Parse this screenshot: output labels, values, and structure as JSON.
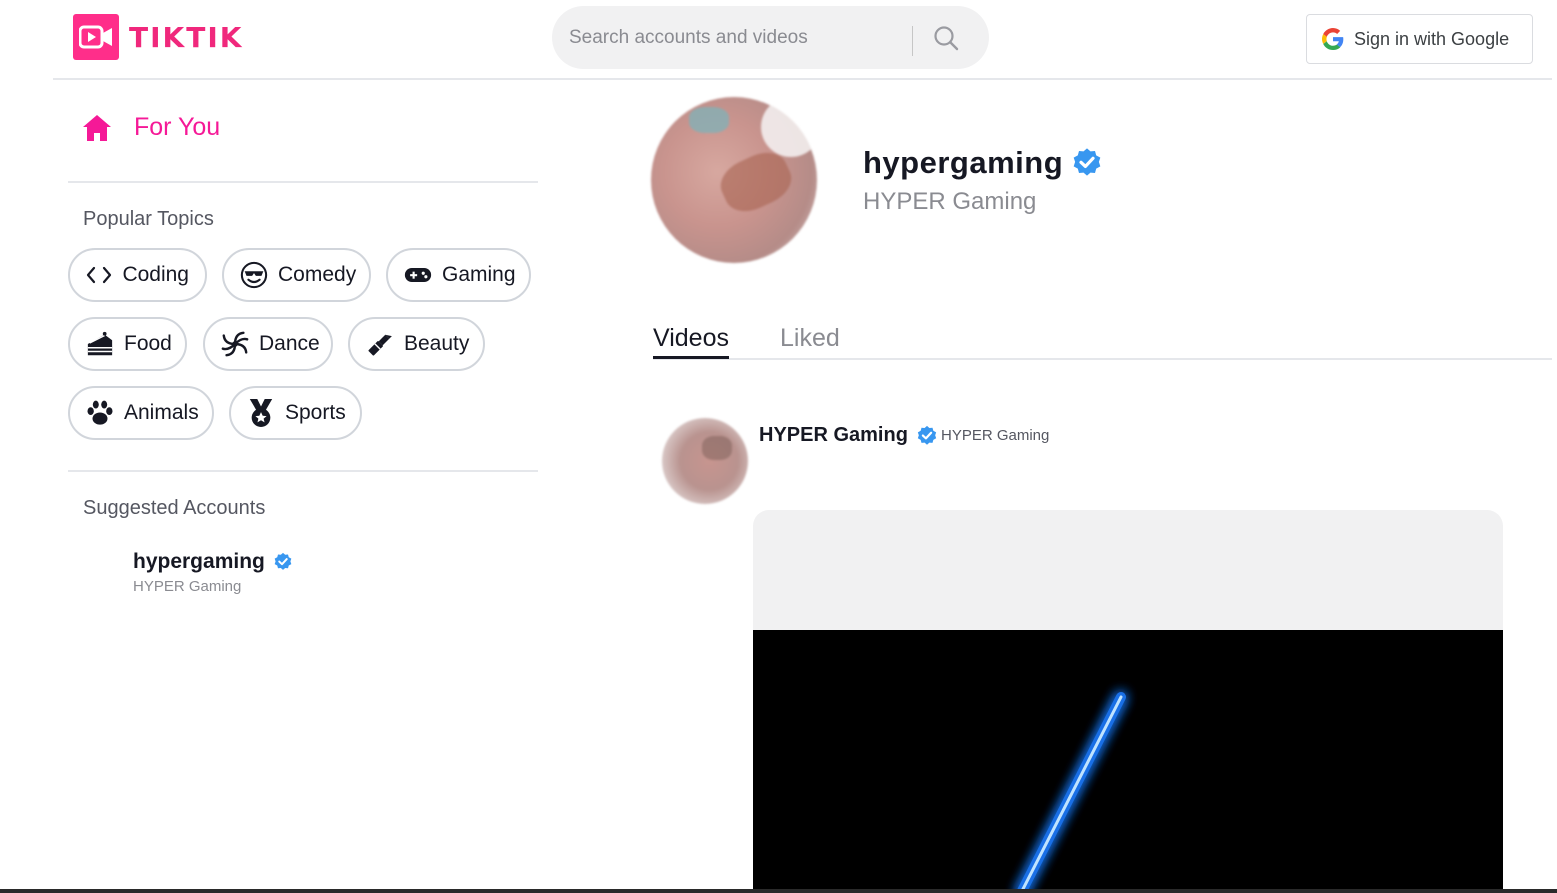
{
  "brand": {
    "name": "TIKTIK",
    "color": "#f0287c"
  },
  "search": {
    "placeholder": "Search accounts and videos"
  },
  "auth": {
    "google_label": "Sign in with Google"
  },
  "sidebar": {
    "for_you_label": "For You",
    "popular_topics_title": "Popular Topics",
    "topics": [
      {
        "label": "Coding",
        "icon": "code-icon"
      },
      {
        "label": "Comedy",
        "icon": "sunglasses-face-icon"
      },
      {
        "label": "Gaming",
        "icon": "gamepad-icon"
      },
      {
        "label": "Food",
        "icon": "cake-icon"
      },
      {
        "label": "Dance",
        "icon": "spiral-icon"
      },
      {
        "label": "Beauty",
        "icon": "lipstick-icon"
      },
      {
        "label": "Animals",
        "icon": "paw-icon"
      },
      {
        "label": "Sports",
        "icon": "medal-icon"
      }
    ],
    "suggested_title": "Suggested Accounts",
    "suggested": [
      {
        "username": "hypergaming",
        "display_name": "HYPER Gaming",
        "verified": true
      }
    ]
  },
  "profile": {
    "username": "hypergaming",
    "display_name": "HYPER Gaming",
    "verified": true
  },
  "tabs": [
    {
      "label": "Videos",
      "active": true
    },
    {
      "label": "Liked",
      "active": false
    }
  ],
  "post": {
    "name": "HYPER Gaming",
    "handle": "HYPER Gaming",
    "verified": true
  },
  "colors": {
    "accent": "#f51997",
    "verified": "#3897f0"
  }
}
